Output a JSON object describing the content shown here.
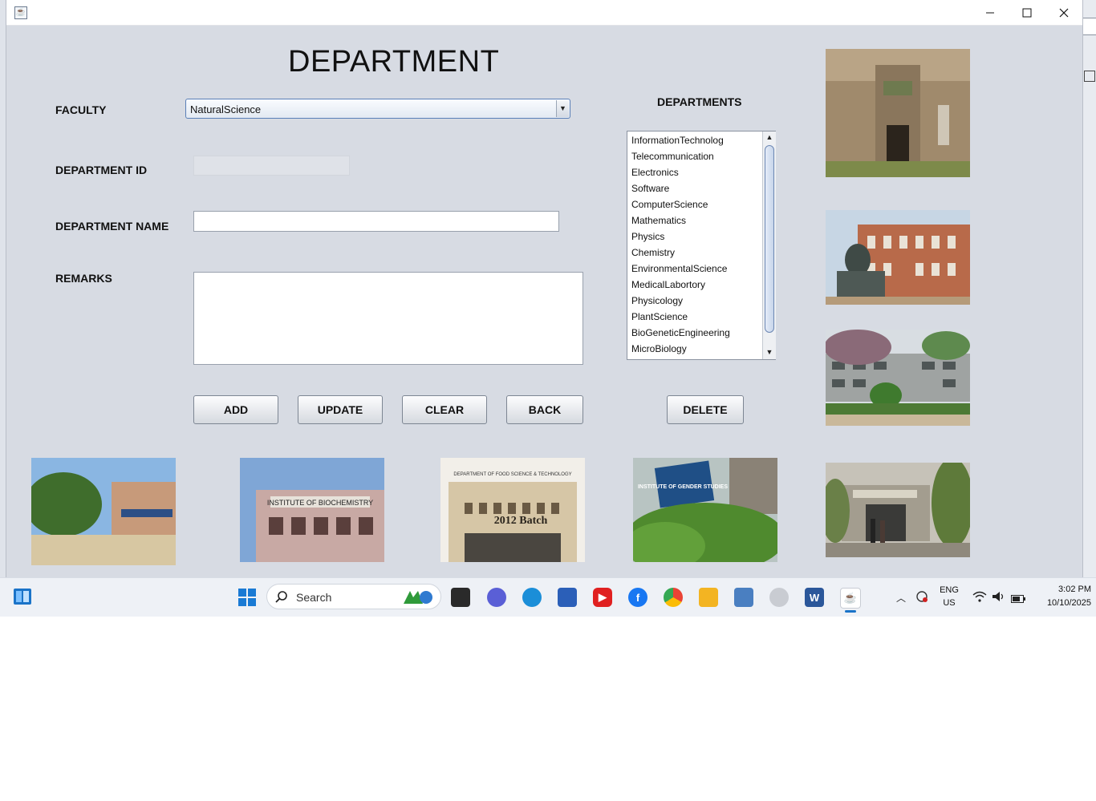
{
  "window": {
    "title": ""
  },
  "form": {
    "heading": "DEPARTMENT",
    "faculty_label": "FACULTY",
    "faculty_selected": "NaturalScience",
    "department_id_label": "DEPARTMENT ID",
    "department_id_value": "",
    "department_name_label": "DEPARTMENT NAME",
    "department_name_value": "",
    "remarks_label": "REMARKS",
    "remarks_value": ""
  },
  "buttons": {
    "add": "ADD",
    "update": "UPDATE",
    "clear": "CLEAR",
    "back": "BACK",
    "delete": "DELETE"
  },
  "departments": {
    "title": "DEPARTMENTS",
    "items": [
      "InformationTechnolog",
      "Telecommunication",
      "Electronics",
      "Software",
      "ComputerScience",
      "Mathematics",
      "Physics",
      "Chemistry",
      "EnvironmentalScience",
      "MedicalLabortory",
      "Physicology",
      "PlantScience",
      "BioGeneticEngineering",
      "MicroBiology"
    ]
  },
  "photos": {
    "sign_biochemistry": "INSTITUTE OF BIOCHEMISTRY",
    "sign_food_science": "DEPARTMENT OF FOOD SCIENCE & TECHNOLOGY",
    "sign_food_batch": "2012 Batch",
    "sign_gender": "INSTITUTE OF GENDER STUDIES"
  },
  "taskbar": {
    "search_placeholder": "Search",
    "lang_top": "ENG",
    "lang_bottom": "US",
    "time": "3:02 PM",
    "date": "10/10/2025"
  }
}
